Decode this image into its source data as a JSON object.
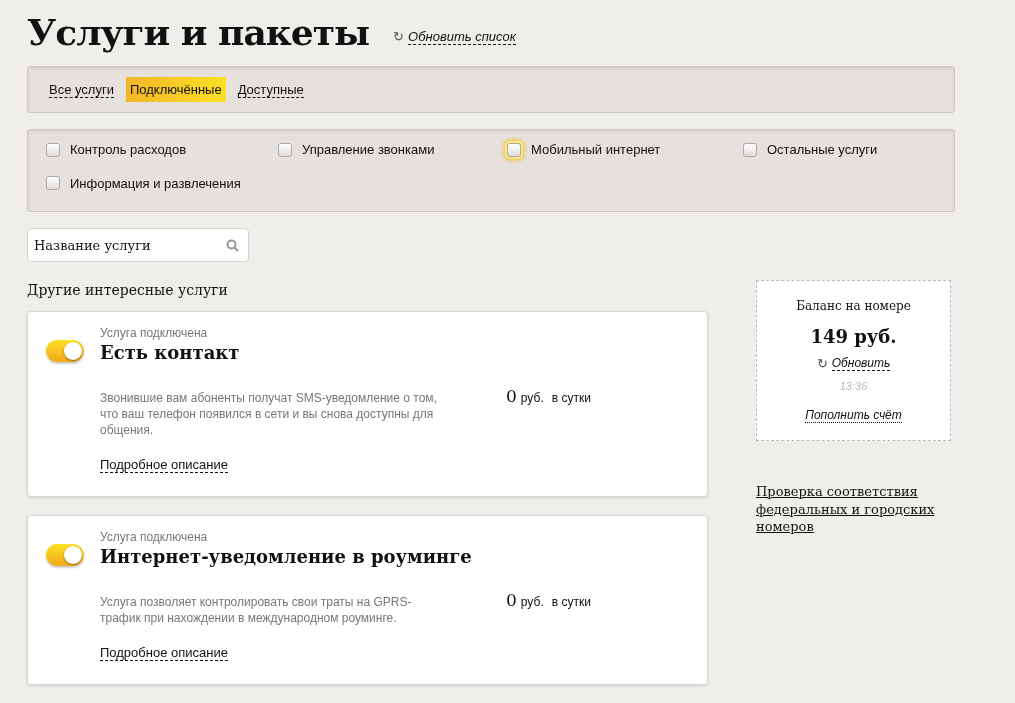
{
  "title": "Услуги и пакеты",
  "refresh_list": {
    "icon": "↻",
    "label": "Обновить список"
  },
  "tabs": [
    {
      "label": "Все услуги",
      "selected": false
    },
    {
      "label": "Подключённые",
      "selected": true
    },
    {
      "label": "Доступные",
      "selected": false
    }
  ],
  "filters": [
    {
      "label": "Контроль расходов",
      "checked": false,
      "highlighted": false
    },
    {
      "label": "Управление звонками",
      "checked": false,
      "highlighted": false
    },
    {
      "label": "Мобильный интернет",
      "checked": false,
      "highlighted": true
    },
    {
      "label": "Остальные услуги",
      "checked": false,
      "highlighted": false
    },
    {
      "label": "Информация и развлечения",
      "checked": false,
      "highlighted": false
    }
  ],
  "search": {
    "placeholder": "Название услуги"
  },
  "section_title": "Другие интересные услуги",
  "services": [
    {
      "status": "Услуга подключена",
      "name": "Есть контакт",
      "on": true,
      "description": "Звонившие вам абоненты получат SMS-уведомление о том, что ваш телефон появился в сети и вы снова доступны для общения.",
      "price": "0",
      "currency": "руб.",
      "period": "в сутки",
      "details_link": "Подробное описание"
    },
    {
      "status": "Услуга подключена",
      "name": "Интернет-уведомление в роуминге",
      "on": true,
      "description": "Услуга позволяет контролировать свои траты на GPRS-трафик при нахождении в международном роуминге.",
      "price": "0",
      "currency": "руб.",
      "period": "в сутки",
      "details_link": "Подробное описание"
    }
  ],
  "balance": {
    "label": "Баланс на номере",
    "amount": "149 руб.",
    "refresh_icon": "↻",
    "refresh_label": "Обновить",
    "time": "13:36",
    "top_up": "Пополнить счёт"
  },
  "check_link": "Проверка соответствия федеральных и городских номеров"
}
